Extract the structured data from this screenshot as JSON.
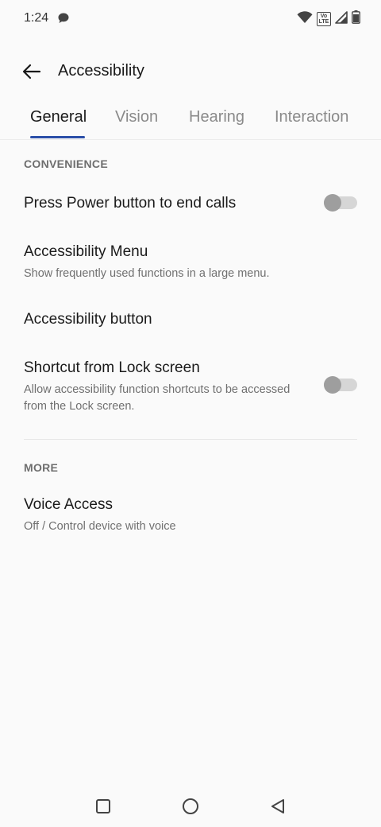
{
  "status_bar": {
    "time": "1:24",
    "icons": [
      "message-icon",
      "wifi-icon",
      "volte-icon",
      "signal-icon",
      "battery-icon"
    ],
    "volte_top": "Vo",
    "volte_bottom": "LTE"
  },
  "header": {
    "title": "Accessibility",
    "back_icon": "arrow-left-icon"
  },
  "tabs": [
    {
      "label": "General",
      "active": true
    },
    {
      "label": "Vision",
      "active": false
    },
    {
      "label": "Hearing",
      "active": false
    },
    {
      "label": "Interaction",
      "active": false
    }
  ],
  "sections": {
    "convenience": {
      "header": "CONVENIENCE",
      "items": [
        {
          "title": "Press Power button to end calls",
          "subtitle": "",
          "toggle": false
        },
        {
          "title": "Accessibility Menu",
          "subtitle": "Show frequently used functions in a large menu."
        },
        {
          "title": "Accessibility button",
          "subtitle": ""
        },
        {
          "title": "Shortcut from Lock screen",
          "subtitle": "Allow accessibility function shortcuts to be accessed from the Lock screen.",
          "toggle": false
        }
      ]
    },
    "more": {
      "header": "MORE",
      "items": [
        {
          "title": "Voice Access",
          "subtitle": "Off / Control device with voice"
        }
      ]
    }
  },
  "nav_bar": {
    "buttons": [
      "recents-square-icon",
      "home-circle-icon",
      "back-triangle-icon"
    ]
  },
  "colors": {
    "background": "#fafafa",
    "accent": "#2b4fa8",
    "toggle_off_track": "#d6d6d6",
    "toggle_off_thumb": "#9e9e9e"
  }
}
